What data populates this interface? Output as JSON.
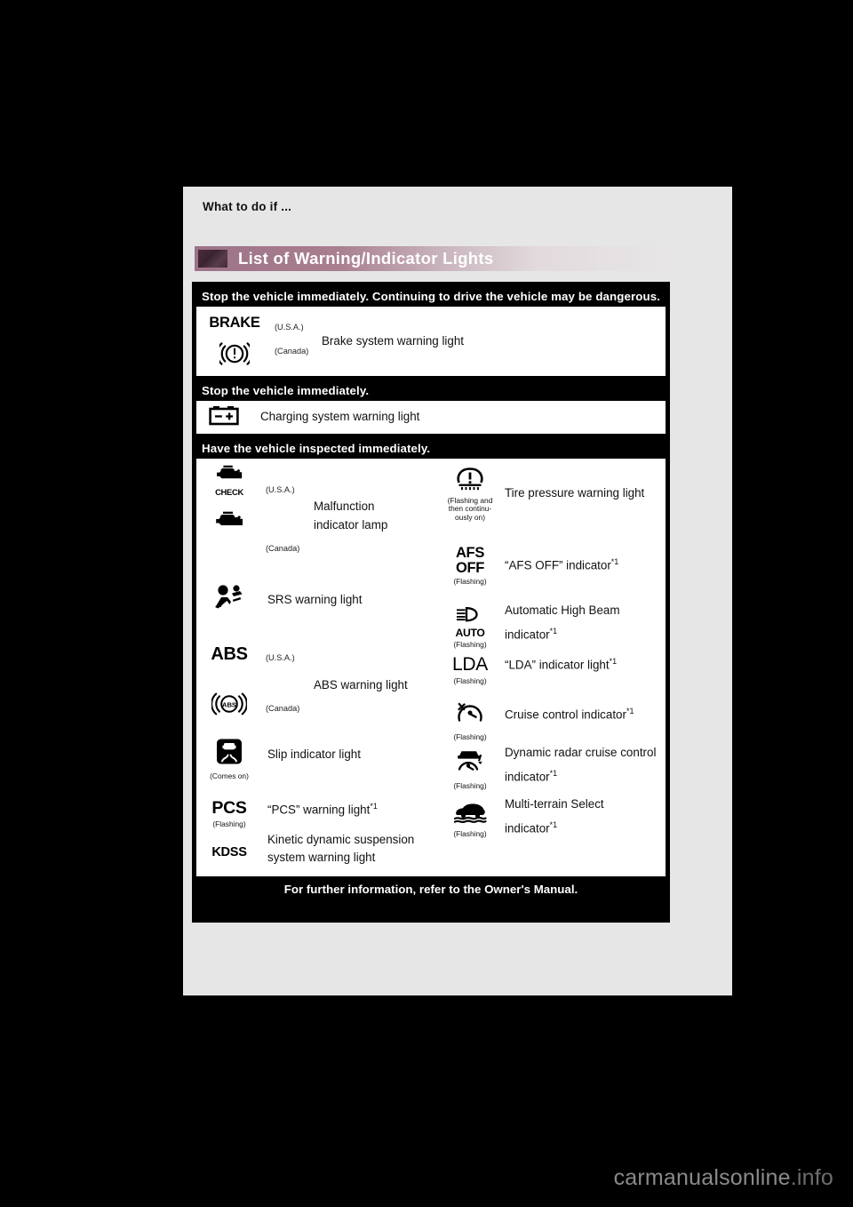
{
  "breadcrumb": {
    "label": "What to do if ..."
  },
  "section": {
    "title": "List of Warning/Indicator Lights"
  },
  "bands": {
    "danger": "Stop the vehicle immediately. Continuing to drive the vehicle may be dangerous.",
    "stop": "Stop the vehicle immediately.",
    "inspect": "Have the vehicle inspected immediately.",
    "footer": "For further information, refer to the Owner's Manual."
  },
  "notes": {
    "usa": "(U.S.A.)",
    "canada": "(Canada)",
    "flashing": "(Flashing)",
    "comes_on": "(Comes on)",
    "flashing_then_on": "(Flashing and then continu- ously on)"
  },
  "rows": {
    "brake": {
      "icon_text": "BRAKE",
      "usa": "(U.S.A.)",
      "canada": "(Canada)",
      "label": "Brake system warning light"
    },
    "charging": {
      "label": "Charging system warning light",
      "icon": "battery-icon"
    },
    "malfunction": {
      "icon_text": "CHECK",
      "usa": "(U.S.A.)",
      "canada": "(Canada)",
      "label_line1": "Malfunction",
      "label_line2": "indicator lamp"
    },
    "srs": {
      "label": "SRS warning light",
      "icon": "srs-airbag-icon"
    },
    "abs": {
      "icon_text": "ABS",
      "usa": "(U.S.A.)",
      "canada": "(Canada)",
      "label": "ABS warning light"
    },
    "slip": {
      "label": "Slip indicator light",
      "note": "(Comes on)"
    },
    "pcs": {
      "icon_text": "PCS",
      "note": "(Flashing)",
      "label": "“PCS” warning light",
      "sup": "*1"
    },
    "kdss": {
      "icon_text": "KDSS",
      "label_line1": "Kinetic dynamic suspension",
      "label_line2": "system warning light"
    },
    "tire": {
      "label": "Tire pressure warning light",
      "note_line1": "(Flashing and",
      "note_line2": "then continu-",
      "note_line3": "ously on)"
    },
    "afs": {
      "icon_line1": "AFS",
      "icon_line2": "OFF",
      "note": "(Flashing)",
      "label": "“AFS OFF” indicator",
      "sup": "*1"
    },
    "ahb": {
      "icon_text": "AUTO",
      "note": "(Flashing)",
      "label_line1": "Automatic High Beam",
      "label_line2": "indicator",
      "sup": "*1"
    },
    "lda": {
      "icon_text": "LDA",
      "note": "(Flashing)",
      "label": "“LDA” indicator light",
      "sup": "*1"
    },
    "cruise": {
      "note": "(Flashing)",
      "label": "Cruise control indicator",
      "sup": "*1"
    },
    "radar_cruise": {
      "note": "(Flashing)",
      "label_line1": "Dynamic radar cruise control",
      "label_line2": "indicator",
      "sup": "*1"
    },
    "mts": {
      "note": "(Flashing)",
      "label_line1": "Multi-terrain Select",
      "label_line2": "indicator",
      "sup": "*1"
    }
  },
  "watermark": {
    "text": "carmanualsonline",
    "suffix": ".info"
  },
  "colors": {
    "page_background": "#000000",
    "sheet": "#e6e6e6",
    "heading_start": "#9d7387",
    "heading_end": "#e8e6e6",
    "table_border": "#000000",
    "cell": "#ffffff"
  }
}
